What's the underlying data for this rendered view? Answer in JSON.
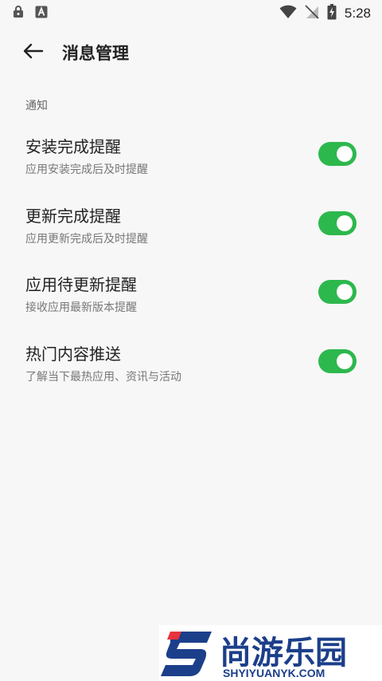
{
  "status_bar": {
    "time": "5:28",
    "icons": [
      "lock-notification-icon",
      "a-notification-icon",
      "wifi-icon",
      "no-sim-icon",
      "battery-charging-icon"
    ]
  },
  "header": {
    "back_icon": "arrow-left-icon",
    "title": "消息管理"
  },
  "section": {
    "label": "通知"
  },
  "settings": [
    {
      "title": "安装完成提醒",
      "description": "应用安装完成后及时提醒",
      "enabled": true
    },
    {
      "title": "更新完成提醒",
      "description": "应用更新完成后及时提醒",
      "enabled": true
    },
    {
      "title": "应用待更新提醒",
      "description": "接收应用最新版本提醒",
      "enabled": true
    },
    {
      "title": "热门内容推送",
      "description": "了解当下最热应用、资讯与活动",
      "enabled": true
    }
  ],
  "colors": {
    "toggle_on": "#2db84d",
    "background": "#f7f7f7",
    "watermark_blue": "#1c3f8a",
    "watermark_red": "#e8323c"
  },
  "watermark": {
    "name_cn": "尚游乐园",
    "name_en": "SHYIYUANYK.COM"
  }
}
